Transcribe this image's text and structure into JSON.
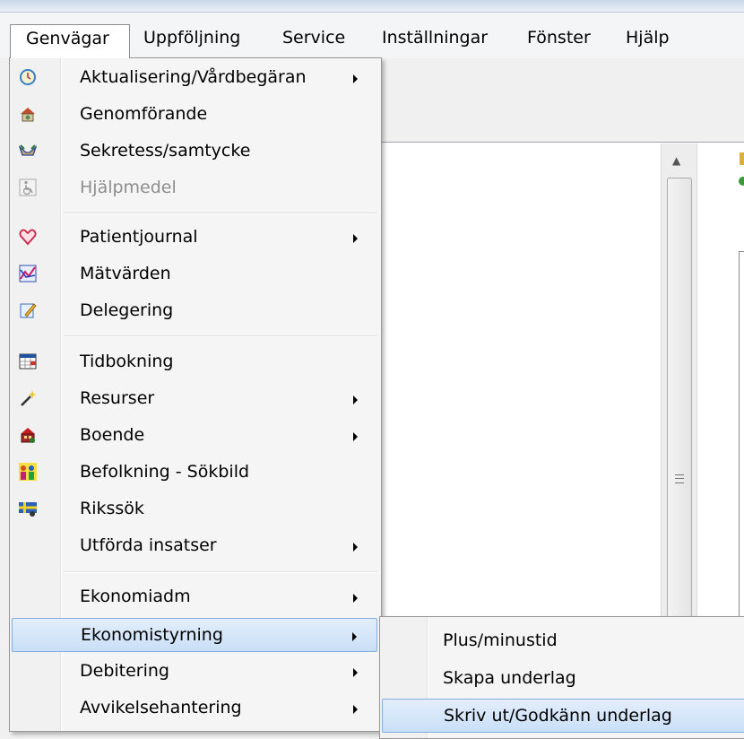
{
  "menubar": {
    "items": [
      "Genvägar",
      "Uppföljning",
      "Service",
      "Inställningar",
      "Fönster",
      "Hjälp"
    ]
  },
  "main_menu": {
    "items": [
      {
        "label": "Aktualisering/Vårdbegäran",
        "icon": "clock-icon",
        "submenu": true
      },
      {
        "label": "Genomförande",
        "icon": "house-icon"
      },
      {
        "label": "Sekretess/samtycke",
        "icon": "hands-icon"
      },
      {
        "label": "Hjälpmedel",
        "icon": "wheelchair-icon",
        "disabled": true
      },
      {
        "label": "Patientjournal",
        "icon": "heart-icon",
        "submenu": true
      },
      {
        "label": "Mätvärden",
        "icon": "chart-icon"
      },
      {
        "label": "Delegering",
        "icon": "pencil-note-icon"
      },
      {
        "label": "Tidbokning",
        "icon": "calendar-icon"
      },
      {
        "label": "Resurser",
        "icon": "wand-icon",
        "submenu": true
      },
      {
        "label": "Boende",
        "icon": "building-icon",
        "submenu": true
      },
      {
        "label": "Befolkning - Sökbild",
        "icon": "people-icon"
      },
      {
        "label": "Rikssök",
        "icon": "swedish-flag-icon"
      },
      {
        "label": "Utförda insatser",
        "submenu": true
      },
      {
        "label": "Ekonomiadm",
        "submenu": true
      },
      {
        "label": "Ekonomistyrning",
        "submenu": true,
        "highlighted": true
      },
      {
        "label": "Debitering",
        "submenu": true
      },
      {
        "label": "Avvikelsehantering",
        "submenu": true
      }
    ]
  },
  "sub_menu": {
    "items": [
      {
        "label": "Plus/minustid"
      },
      {
        "label": "Skapa underlag"
      },
      {
        "label": "Skriv ut/Godkänn underlag",
        "highlighted": true
      }
    ]
  },
  "colors": {
    "highlight": "#cce0f7",
    "highlight_border": "#84acdd",
    "disabled_text": "#8d8d8d"
  }
}
